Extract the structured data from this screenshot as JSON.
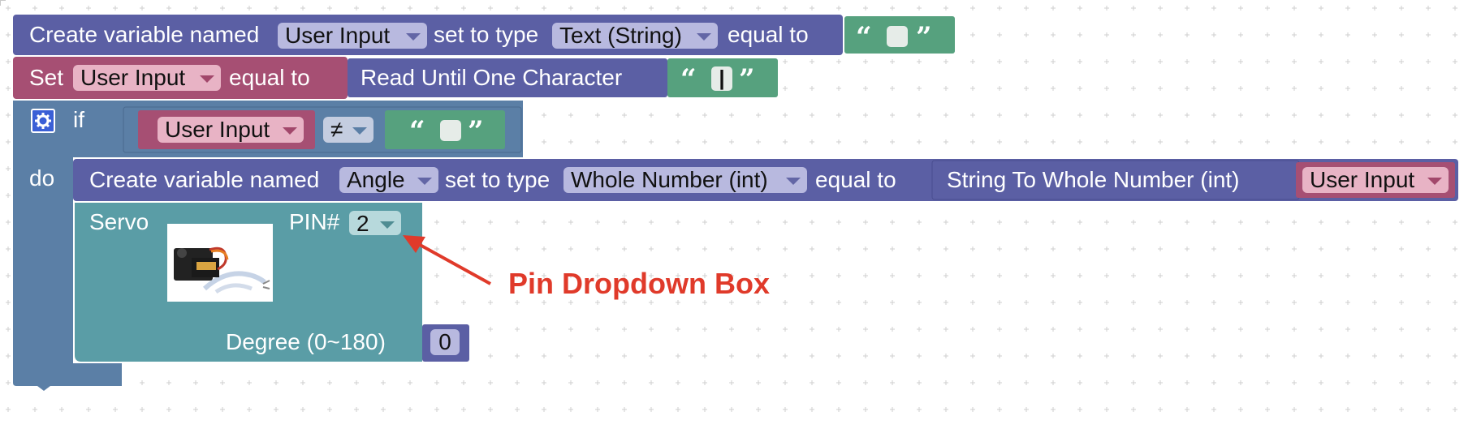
{
  "colors": {
    "variable_block": "#5b5fa4",
    "set_block": "#a64f73",
    "string_block": "#56a17e",
    "logic_block": "#5b7fa6",
    "servo_block": "#5a9da6",
    "annotation": "#e03a2a"
  },
  "blocks": {
    "create_var_1": {
      "prefix": "Create variable named",
      "var_name": "User Input",
      "mid": "set to type",
      "type": "Text (String)",
      "suffix": "equal to",
      "open_quote": "“",
      "close_quote": "”",
      "string_value": ""
    },
    "set_block": {
      "prefix": "Set",
      "var_name": "User Input",
      "suffix": "equal to",
      "read_label": "Read Until One Character",
      "open_quote": "“",
      "close_quote": "”",
      "char_value": "|"
    },
    "if_block": {
      "gear_icon": "gear-icon",
      "if_label": "if",
      "do_label": "do",
      "var_name": "User Input",
      "operator": "≠",
      "open_quote": "“",
      "close_quote": "”",
      "string_value": ""
    },
    "create_var_2": {
      "prefix": "Create variable named",
      "var_name": "Angle",
      "mid": "set to type",
      "type": "Whole Number (int)",
      "suffix": "equal to",
      "convert_label": "String To Whole Number (int)",
      "input_var": "User Input"
    },
    "servo": {
      "label": "Servo",
      "pin_label": "PIN#",
      "pin_value": "2",
      "degree_label": "Degree (0~180)",
      "degree_value": "0",
      "image_alt": "servo-motor-image"
    }
  },
  "annotation": {
    "text": "Pin Dropdown Box"
  }
}
